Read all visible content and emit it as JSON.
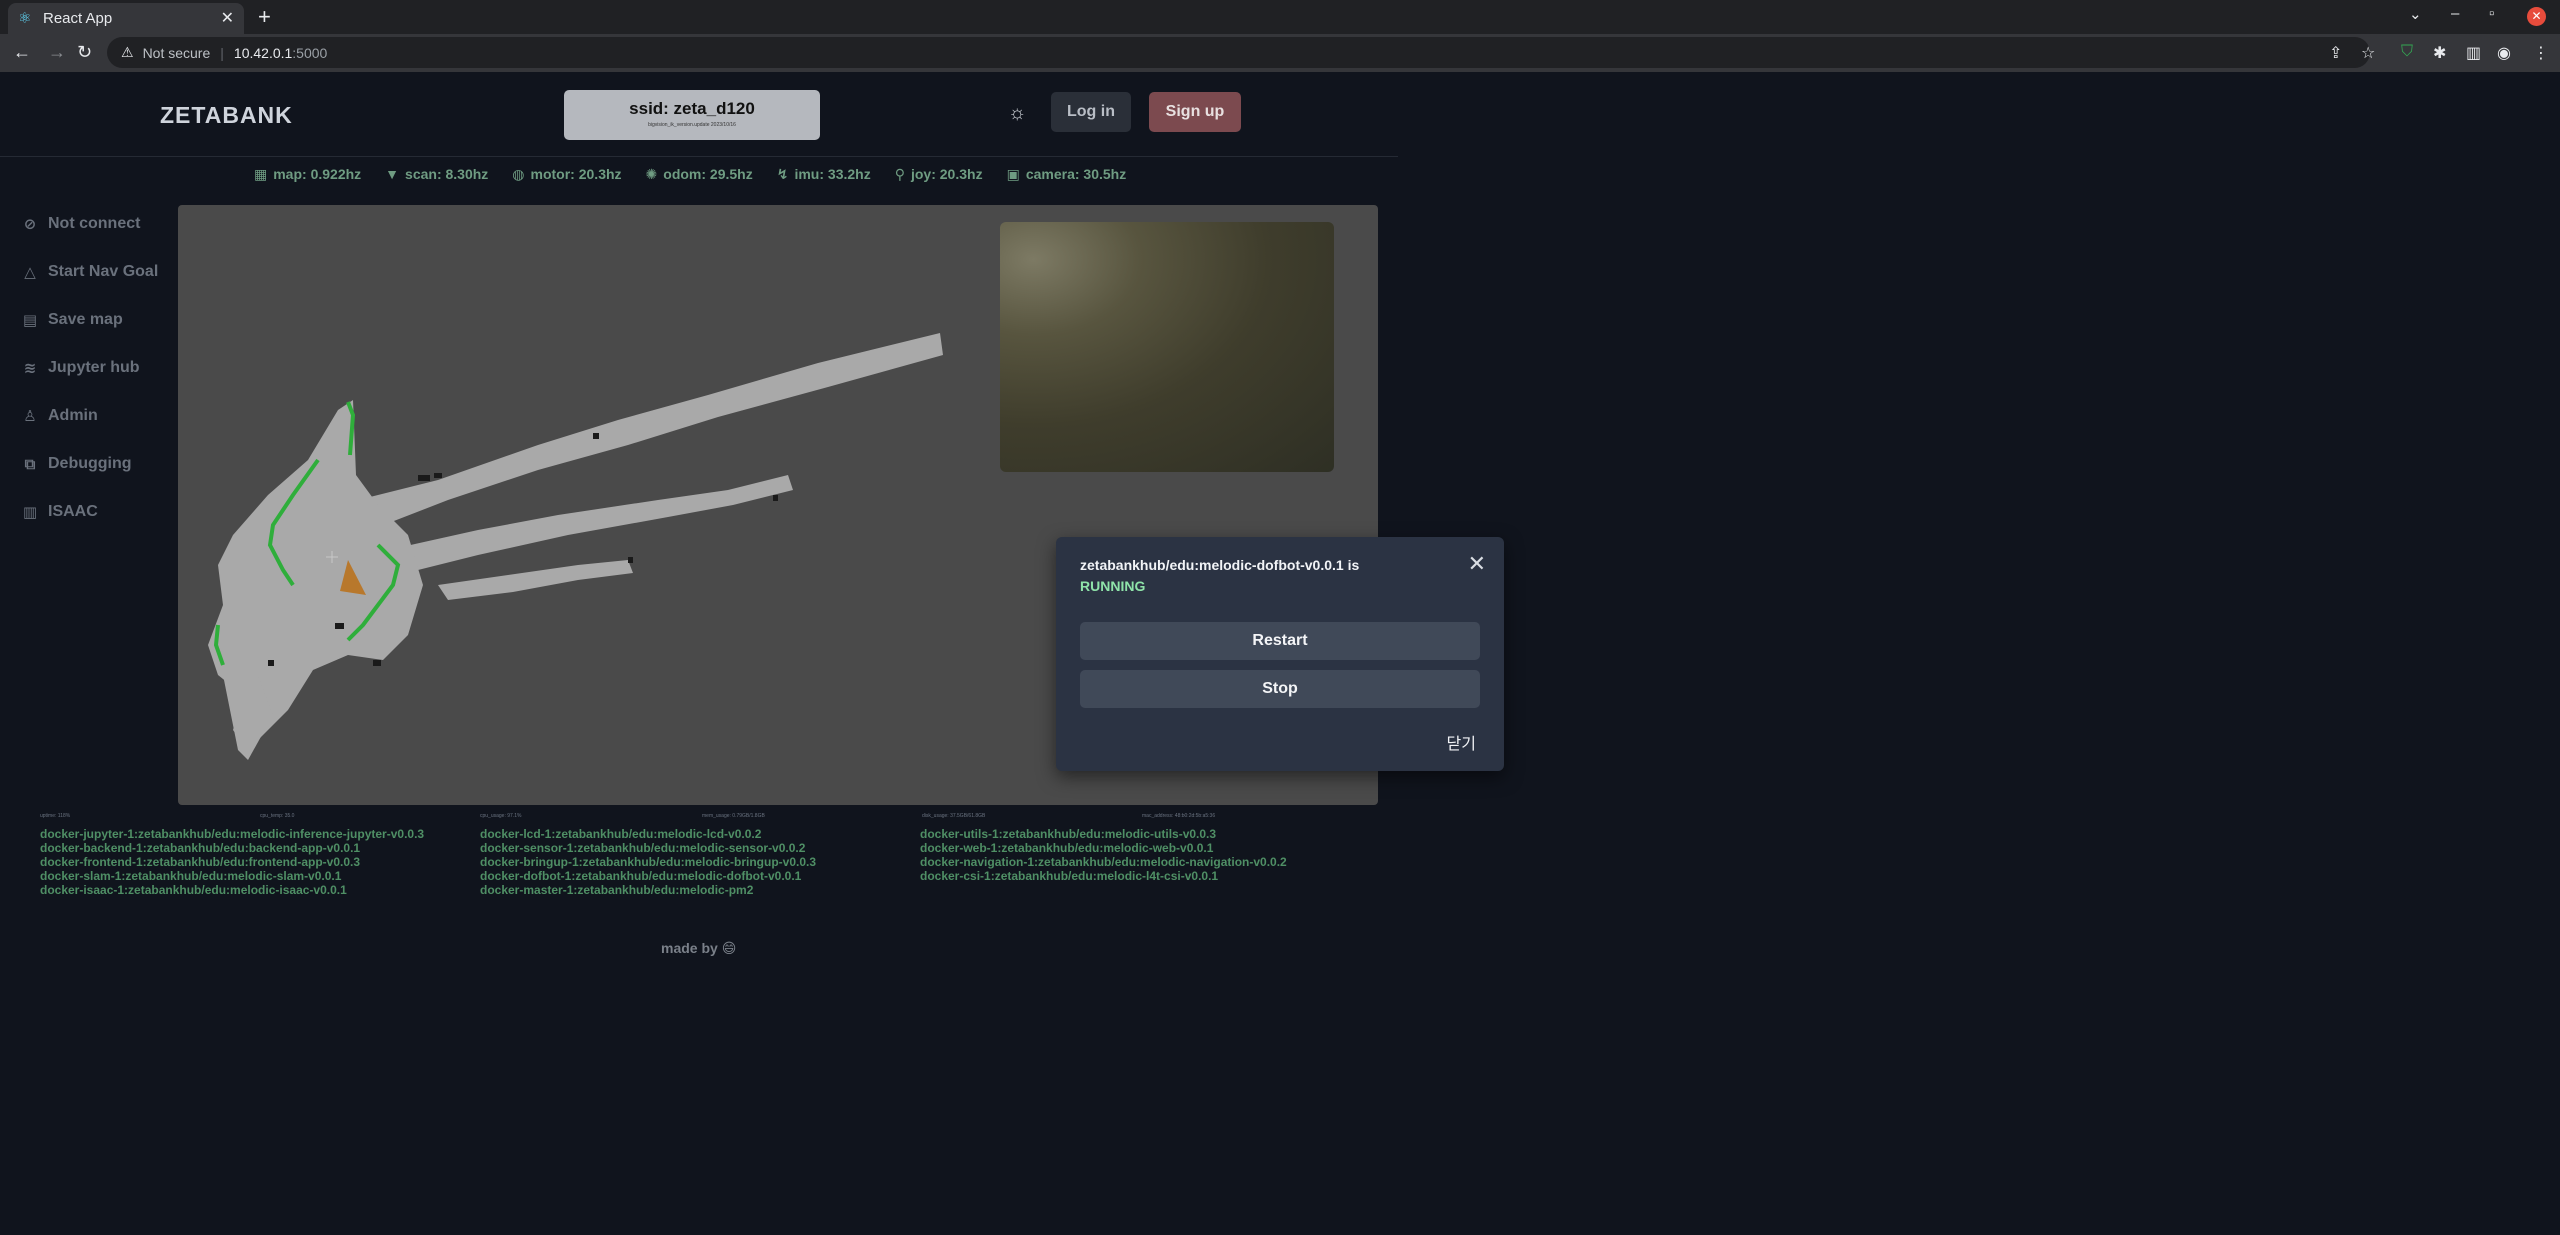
{
  "browser": {
    "tab_title": "React App",
    "tab_icon": "react-icon",
    "new_tab": "+",
    "not_secure": "Not secure",
    "url_host": "10.42.0.1",
    "url_port": ":5000"
  },
  "header": {
    "logo": "ZETABANK",
    "ssid": "ssid: zeta_d120",
    "ssid_sub": "bigvision_ik_version.update 2023/10/16",
    "login": "Log in",
    "signup": "Sign up"
  },
  "status": [
    {
      "icon": "map-icon",
      "text": "map: 0.922hz"
    },
    {
      "icon": "wifi-icon",
      "text": "scan: 8.30hz"
    },
    {
      "icon": "motor-icon",
      "text": "motor: 20.3hz"
    },
    {
      "icon": "odom-icon",
      "text": "odom: 29.5hz"
    },
    {
      "icon": "imu-icon",
      "text": "imu: 33.2hz"
    },
    {
      "icon": "joystick-icon",
      "text": "joy: 20.3hz"
    },
    {
      "icon": "camera-icon",
      "text": "camera: 30.5hz"
    }
  ],
  "sidebar": {
    "items": [
      {
        "icon": "compass-icon",
        "label": "Not connect"
      },
      {
        "icon": "navigation-icon",
        "label": "Start Nav Goal"
      },
      {
        "icon": "save-map-icon",
        "label": "Save map"
      },
      {
        "icon": "jupyter-icon",
        "label": "Jupyter hub"
      },
      {
        "icon": "user-icon",
        "label": "Admin"
      },
      {
        "icon": "debug-icon",
        "label": "Debugging"
      },
      {
        "icon": "chart-icon",
        "label": "ISAAC"
      }
    ]
  },
  "modal": {
    "title": "zetabankhub/edu:melodic-dofbot-v0.0.1 is",
    "status": "RUNNING",
    "restart": "Restart",
    "stop": "Stop",
    "close": "닫기"
  },
  "system": {
    "uptime": "uptime: 118%",
    "cpu_temp": "cpu_temp: 35.0",
    "cpu_usage": "cpu_usage: 97.1%",
    "mem_usage": "mem_usage: 0.79GB/1.8GB",
    "disk_usage": "disk_usage: 37.5GB/61.8GB",
    "mac_address": "mac_address: 48:b0:2d:5b:a5:36"
  },
  "containers": {
    "col1": [
      "docker-jupyter-1:zetabankhub/edu:melodic-inference-jupyter-v0.0.3",
      "docker-backend-1:zetabankhub/edu:backend-app-v0.0.1",
      "docker-frontend-1:zetabankhub/edu:frontend-app-v0.0.3",
      "docker-slam-1:zetabankhub/edu:melodic-slam-v0.0.1",
      "docker-isaac-1:zetabankhub/edu:melodic-isaac-v0.0.1"
    ],
    "col2": [
      "docker-lcd-1:zetabankhub/edu:melodic-lcd-v0.0.2",
      "docker-sensor-1:zetabankhub/edu:melodic-sensor-v0.0.2",
      "docker-bringup-1:zetabankhub/edu:melodic-bringup-v0.0.3",
      "docker-dofbot-1:zetabankhub/edu:melodic-dofbot-v0.0.1",
      "docker-master-1:zetabankhub/edu:melodic-pm2"
    ],
    "col3": [
      "docker-utils-1:zetabankhub/edu:melodic-utils-v0.0.3",
      "docker-web-1:zetabankhub/edu:melodic-web-v0.0.1",
      "docker-navigation-1:zetabankhub/edu:melodic-navigation-v0.0.2",
      "docker-csi-1:zetabankhub/edu:melodic-l4t-csi-v0.0.1"
    ]
  },
  "footer": {
    "made_by": "made by 😄"
  },
  "colors": {
    "background": "#10141d",
    "accent_green": "#6f9c82",
    "running": "#8fe3a9",
    "signup": "#7c4a4f"
  }
}
